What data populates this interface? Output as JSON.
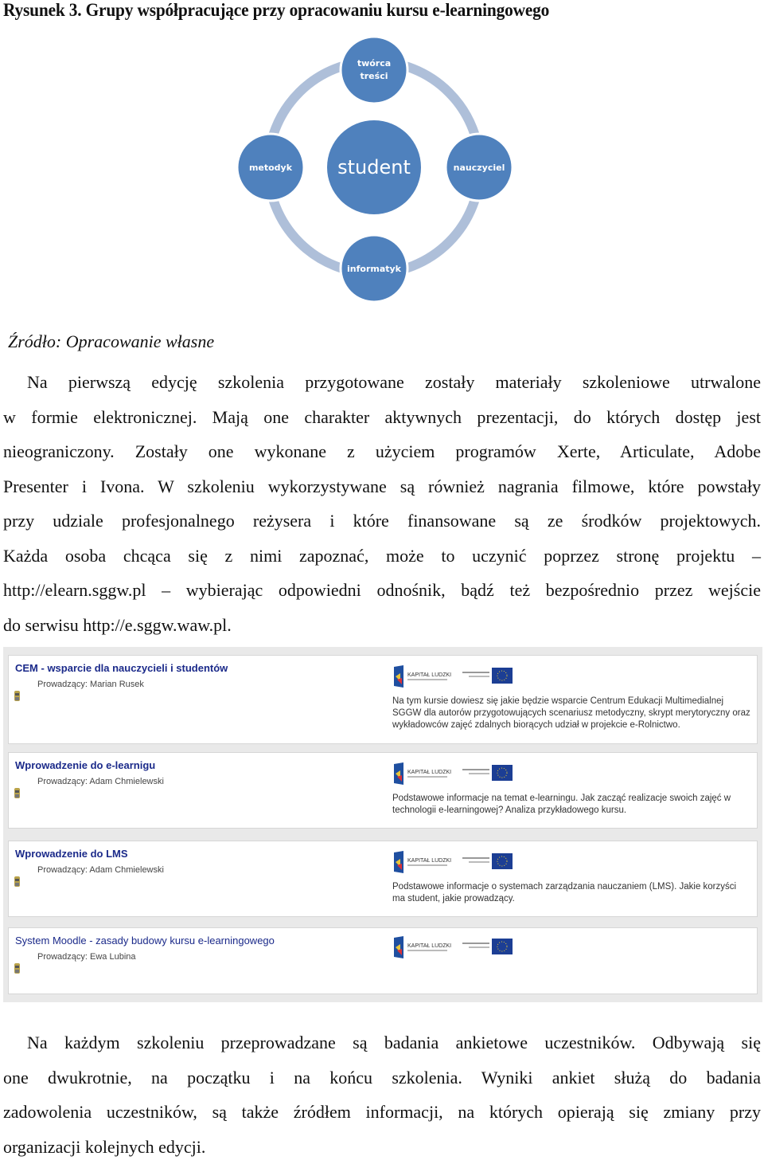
{
  "figure": {
    "caption": "Rysunek 3. Grupy współpracujące przy opracowaniu kursu e-learningowego",
    "center_node": "student",
    "nodes": {
      "top": [
        "twórca",
        "treści"
      ],
      "left": "metodyk",
      "right": "nauczyciel",
      "bottom": "informatyk"
    },
    "colors": {
      "node": "#4f81bd",
      "ring": "#aebfd9",
      "text": "#ffffff"
    },
    "source": "Źródło: Opracowanie własne"
  },
  "paragraph1": [
    "Na pierwszą edycję szkolenia przygotowane zostały materiały szkoleniowe utrwalone",
    "w formie elektronicznej. Mają one charakter aktywnych prezentacji, do których dostęp jest",
    "nieograniczony. Zostały one wykonane z użyciem programów Xerte, Articulate, Adobe",
    "Presenter i Ivona. W szkoleniu wykorzystywane są również nagrania filmowe, które powstały",
    "przy udziale profesjonalnego reżysera i które finansowane są ze środków projektowych.",
    "Każda osoba chcąca się z nimi zapoznać, może to uczynić poprzez stronę projektu –",
    "http://elearn.sggw.pl – wybierając odpowiedni odnośnik, bądź też bezpośrednio przez wejście",
    "do serwisu http://e.sggw.waw.pl."
  ],
  "courses": [
    {
      "title": "CEM - wsparcie dla nauczycieli i studentów",
      "teacher": "Prowadzący: Marian Rusek",
      "logo_text": "KAPITAŁ LUDZKI",
      "description": "Na tym kursie dowiesz się jakie będzie wsparcie Centrum Edukacji Multimedialnej SGGW dla autorów przygotowujących scenariusz metodyczny, skrypt merytoryczny oraz wykładowców zajęć zdalnych biorących udział w projekcie e-Rolnictwo."
    },
    {
      "title": "Wprowadzenie do e-learnigu",
      "teacher": "Prowadzący: Adam Chmielewski",
      "logo_text": "KAPITAŁ LUDZKI",
      "description": "Podstawowe informacje na temat e-learningu. Jak zacząć realizacje swoich zajęć w technologii e-learningowej? Analiza przykładowego kursu."
    },
    {
      "title": "Wprowadzenie do LMS",
      "teacher": "Prowadzący: Adam Chmielewski",
      "logo_text": "KAPITAŁ LUDZKI",
      "description": "Podstawowe informacje o systemach zarządzania nauczaniem (LMS). Jakie korzyści ma student, jakie prowadzący."
    },
    {
      "title": "System Moodle - zasady budowy kursu e-learningowego",
      "teacher": "Prowadzący: Ewa Lubina",
      "logo_text": "KAPITAŁ LUDZKI",
      "description": ""
    }
  ],
  "paragraph2": [
    "Na każdym szkoleniu przeprowadzane są badania ankietowe uczestników. Odbywają się",
    "one dwukrotnie, na początku i na końcu szkolenia. Wyniki ankiet służą do badania",
    "zadowolenia uczestników, są także źródłem informacji, na których opierają się zmiany przy",
    "organizacji kolejnych edycji."
  ]
}
